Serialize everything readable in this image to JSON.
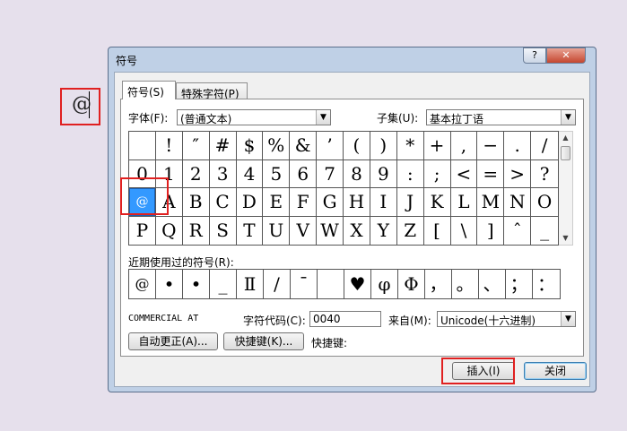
{
  "document": {
    "inserted_symbol": "@"
  },
  "dialog": {
    "title": "符号",
    "help_glyph": "?",
    "close_glyph": "✕",
    "tabs": [
      {
        "label": "符号(S)",
        "active": true
      },
      {
        "label": "特殊字符(P)",
        "active": false
      }
    ],
    "font_label": "字体(F):",
    "font_value": "(普通文本)",
    "subset_label": "子集(U):",
    "subset_value": "基本拉丁语",
    "symbol_grid": [
      [
        "",
        "!",
        "″",
        "#",
        "$",
        "%",
        "&",
        "’",
        "(",
        ")",
        "*",
        "+",
        ",",
        "−",
        ".",
        "/"
      ],
      [
        "0",
        "1",
        "2",
        "3",
        "4",
        "5",
        "6",
        "7",
        "8",
        "9",
        ":",
        ";",
        "<",
        "=",
        ">",
        "?"
      ],
      [
        "@",
        "A",
        "B",
        "C",
        "D",
        "E",
        "F",
        "G",
        "H",
        "I",
        "J",
        "K",
        "L",
        "M",
        "N",
        "O"
      ],
      [
        "P",
        "Q",
        "R",
        "S",
        "T",
        "U",
        "V",
        "W",
        "X",
        "Y",
        "Z",
        "[",
        "\\",
        "]",
        "ˆ",
        "_"
      ]
    ],
    "selected_symbol": "@",
    "recent_label": "近期使用过的符号(R):",
    "recent_symbols": [
      "@",
      "•",
      "•",
      "_",
      "Ⅱ",
      "/",
      "¯",
      " ",
      "♥",
      "φ",
      "Φ",
      "，",
      "。",
      "、",
      "；",
      "："
    ],
    "char_name": "COMMERCIAL AT",
    "char_code_label": "字符代码(C):",
    "char_code_value": "0040",
    "from_label": "来自(M):",
    "from_value": "Unicode(十六进制)",
    "autocorrect_button": "自动更正(A)...",
    "shortcut_button": "快捷键(K)...",
    "shortcut_label": "快捷键:",
    "insert_button": "插入(I)",
    "close_button": "关闭"
  },
  "colors": {
    "highlight": "#e02020",
    "selection": "#3399ff",
    "dialog_frame": "#bfd0e6"
  }
}
